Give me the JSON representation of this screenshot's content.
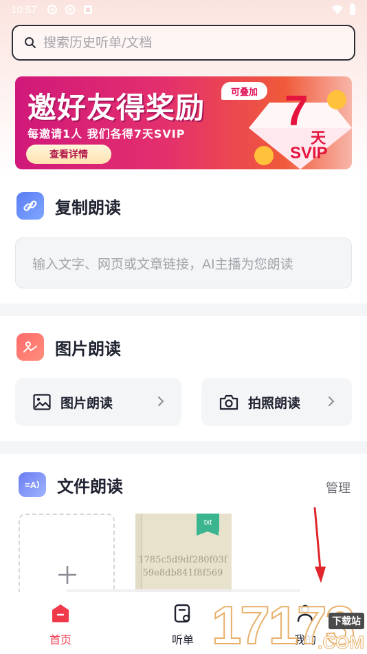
{
  "status_bar": {
    "time": "10:57"
  },
  "search": {
    "placeholder": "搜索历史听单/文档"
  },
  "banner": {
    "title": "邀好友得奖励",
    "subtitle": "每邀请1人 我们各得7天SVIP",
    "button_label": "查看详情",
    "tag": "可叠加",
    "days_number": "7",
    "days_unit": "天",
    "badge": "SVIP"
  },
  "copy_read": {
    "title": "复制朗读",
    "input_placeholder": "输入文字、网页或文章链接，AI主播为您朗读"
  },
  "image_read": {
    "title": "图片朗读",
    "cards": [
      {
        "label": "图片朗读",
        "icon": "image-icon"
      },
      {
        "label": "拍照朗读",
        "icon": "camera-icon"
      }
    ]
  },
  "file_read": {
    "title": "文件朗读",
    "manage_label": "管理",
    "files": [
      {
        "type_tag": "txt",
        "name": "1785c5d9df280f03f59e8db841f8f569"
      }
    ]
  },
  "bottom_nav": {
    "items": [
      {
        "label": "首页",
        "icon": "home-icon",
        "active": true
      },
      {
        "label": "听单",
        "icon": "playlist-icon",
        "active": false
      },
      {
        "label": "我的",
        "icon": "profile-icon",
        "active": false
      }
    ]
  },
  "watermark": {
    "number": "17173",
    "tag": "下载站",
    "domain": ".COM"
  },
  "colors": {
    "accent": "#ef3a4b",
    "text_primary": "#1f2230",
    "text_muted": "#a3a4aa",
    "card_bg": "#f4f5f7",
    "txt_tag": "#3bb58f"
  }
}
